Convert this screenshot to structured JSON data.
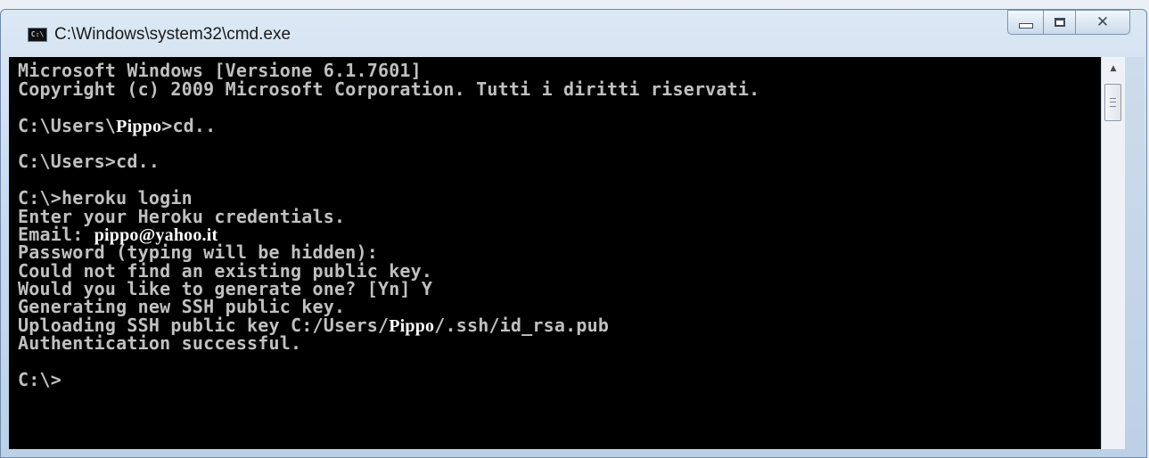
{
  "window": {
    "title": "C:\\Windows\\system32\\cmd.exe",
    "icon_label": "C:\\",
    "minimize_icon": "minimize-icon",
    "maximize_icon": "maximize-icon",
    "close_symbol": "✕"
  },
  "console": {
    "lines": [
      {
        "parts": [
          {
            "t": "Microsoft Windows [Versione 6.1.7601]"
          }
        ]
      },
      {
        "parts": [
          {
            "t": "Copyright (c) 2009 Microsoft Corporation. Tutti i diritti riservati."
          }
        ]
      },
      {
        "parts": [
          {
            "t": "C:\\Users\\"
          },
          {
            "t": "Pippo",
            "hl": true
          },
          {
            "t": ">cd.."
          }
        ]
      },
      {
        "parts": [
          {
            "t": "C:\\Users>cd.."
          }
        ]
      },
      {
        "parts": [
          {
            "t": "C:\\>heroku login"
          }
        ]
      },
      {
        "parts": [
          {
            "t": "Enter your Heroku credentials."
          }
        ]
      },
      {
        "parts": [
          {
            "t": "Email: "
          },
          {
            "t": "pippo@yahoo.it",
            "hl": true
          }
        ]
      },
      {
        "parts": [
          {
            "t": "Password (typing will be hidden):"
          }
        ]
      },
      {
        "parts": [
          {
            "t": "Could not find an existing public key."
          }
        ]
      },
      {
        "parts": [
          {
            "t": "Would you like to generate one? [Yn] Y"
          }
        ]
      },
      {
        "parts": [
          {
            "t": "Generating new SSH public key."
          }
        ]
      },
      {
        "parts": [
          {
            "t": "Uploading SSH public key C:/Users/"
          },
          {
            "t": "Pippo",
            "hl": true
          },
          {
            "t": "/.ssh/id_rsa.pub"
          }
        ]
      },
      {
        "parts": [
          {
            "t": "Authentication successful."
          }
        ]
      },
      {
        "parts": [
          {
            "t": "C:\\>"
          }
        ]
      }
    ]
  },
  "scrollbar": {
    "up_arrow": "▲"
  },
  "colors": {
    "console_bg": "#000000",
    "console_fg": "#c0c0c0",
    "highlight_fg": "#ffffff"
  }
}
